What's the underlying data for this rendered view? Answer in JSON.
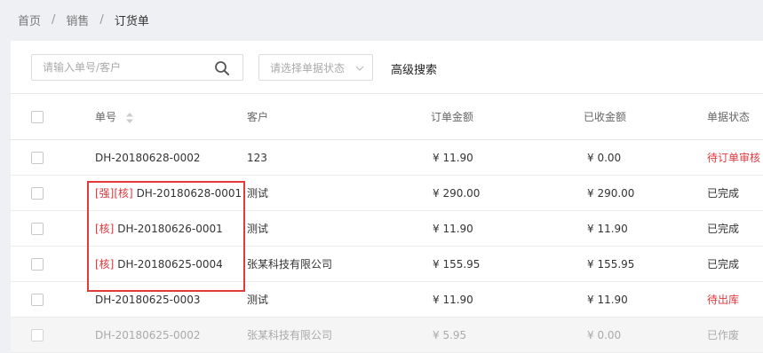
{
  "breadcrumb": {
    "items": [
      "首页",
      "销售",
      "订货单"
    ],
    "separator": "/"
  },
  "toolbar": {
    "search_placeholder": "请输入单号/客户",
    "status_placeholder": "请选择单据状态",
    "advanced_search": "高级搜索"
  },
  "table": {
    "headers": {
      "no": "单号",
      "customer": "客户",
      "amount": "订单金额",
      "received": "已收金额",
      "status": "单据状态"
    },
    "rows": [
      {
        "tags": "",
        "no": "DH-20180628-0002",
        "customer": "123",
        "amount": "¥ 11.90",
        "received": "¥ 0.00",
        "status": "待订单审核"
      },
      {
        "tags": "[强][核]",
        "no": "DH-20180628-0001",
        "customer": "测试",
        "amount": "¥ 290.00",
        "received": "¥ 290.00",
        "status": "已完成"
      },
      {
        "tags": "[核]",
        "no": "DH-20180626-0001",
        "customer": "测试",
        "amount": "¥ 11.90",
        "received": "¥ 11.90",
        "status": "已完成"
      },
      {
        "tags": "[核]",
        "no": "DH-20180625-0004",
        "customer": "张某科技有限公司",
        "amount": "¥ 155.95",
        "received": "¥ 155.95",
        "status": "已完成"
      },
      {
        "tags": "",
        "no": "DH-20180625-0003",
        "customer": "测试",
        "amount": "¥ 11.90",
        "received": "¥ 11.90",
        "status": "待出库"
      },
      {
        "tags": "",
        "no": "DH-20180625-0002",
        "customer": "张某科技有限公司",
        "amount": "¥ 5.95",
        "received": "¥ 0.00",
        "status": "已作废"
      }
    ]
  },
  "colors": {
    "accent_red": "#e0383e",
    "highlight_border": "#e03a3a",
    "background": "#eef0f3"
  },
  "icons": {
    "search": "search-icon",
    "dropdown": "chevron-down-icon",
    "sort": "sort-icon"
  }
}
